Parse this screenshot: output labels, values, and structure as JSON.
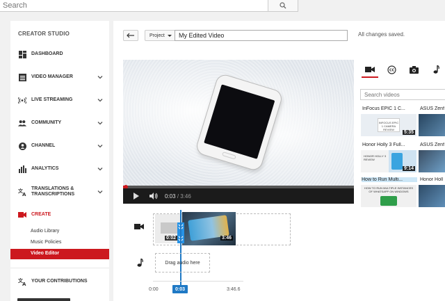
{
  "search": {
    "placeholder": "Search"
  },
  "sidebar": {
    "title": "CREATOR STUDIO",
    "items": [
      {
        "label": "DASHBOARD",
        "icon": "dashboard-icon"
      },
      {
        "label": "VIDEO MANAGER",
        "icon": "video-manager-icon"
      },
      {
        "label": "LIVE STREAMING",
        "icon": "live-streaming-icon"
      },
      {
        "label": "COMMUNITY",
        "icon": "community-icon"
      },
      {
        "label": "CHANNEL",
        "icon": "channel-icon"
      },
      {
        "label": "ANALYTICS",
        "icon": "analytics-icon"
      },
      {
        "label_line1": "TRANSLATIONS &",
        "label_line2": "TRANSCRIPTIONS",
        "icon": "translate-icon"
      },
      {
        "label": "CREATE",
        "icon": "create-icon"
      }
    ],
    "create_sub": [
      "Audio Library",
      "Music Policies",
      "Video Editor"
    ],
    "contributions": "YOUR CONTRIBUTIONS"
  },
  "editor": {
    "project_label": "Project",
    "title_value": "My Edited Video",
    "save_status": "All changes saved."
  },
  "player": {
    "current_time": "0:03",
    "duration": "/ 3:46",
    "progress_fraction": 0.013
  },
  "right_panel": {
    "search_placeholder": "Search videos",
    "videos": [
      {
        "title": "InFocus EPIC 1 C...",
        "duration": "5:35",
        "thumb_text": "INFOCUS EPIC 1 CAMERA REVIEW"
      },
      {
        "title": "ASUS Zenf",
        "duration": ""
      },
      {
        "title": "Honor Holly 3 Full...",
        "duration": "9:14",
        "thumb_text": "HONOR HOLLY 3 REVIEW"
      },
      {
        "title": "ASUS Zenf",
        "duration": ""
      },
      {
        "title": "How to Run Multi...",
        "duration": "",
        "thumb_text": "HOW TO RUN MULTIPLE INSTANCES OF WHATSAPP ON WINDOWS"
      },
      {
        "title": "Honor Holl",
        "duration": ""
      }
    ]
  },
  "timeline": {
    "clip_a_duration": "0:02",
    "clip_b_duration": "3:46",
    "audio_placeholder": "Drag audio here",
    "start_label": "0:00",
    "end_label": "3:46.6",
    "current_label": "0:03"
  },
  "colors": {
    "accent": "#cc181e",
    "playhead": "#1f79c5"
  }
}
